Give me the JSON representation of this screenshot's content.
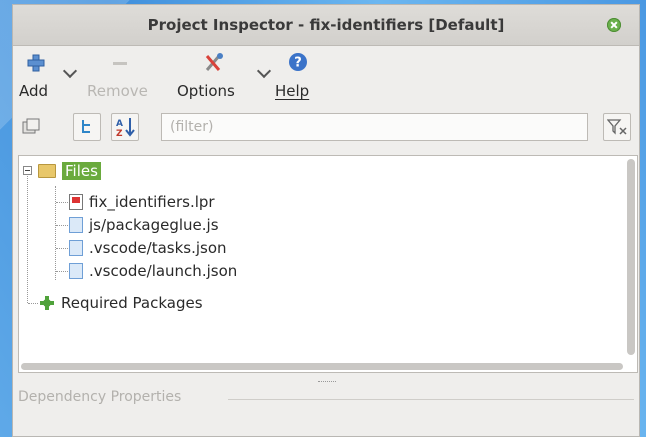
{
  "window": {
    "title": "Project Inspector - fix-identifiers [Default]"
  },
  "toolbar": {
    "add_label": "Add",
    "remove_label": "Remove",
    "options_label": "Options",
    "help_label": "Help"
  },
  "filter": {
    "placeholder": "(filter)"
  },
  "tree": {
    "root_label": "Files",
    "files": [
      {
        "name": "fix_identifiers.lpr",
        "icon": "lpr-file-icon"
      },
      {
        "name": "js/packageglue.js",
        "icon": "file-icon"
      },
      {
        "name": ".vscode/tasks.json",
        "icon": "file-icon"
      },
      {
        "name": ".vscode/launch.json",
        "icon": "file-icon"
      }
    ],
    "required_packages_label": "Required Packages"
  },
  "dependency_properties": {
    "title": "Dependency Properties"
  },
  "colors": {
    "files_highlight": "#6aaa3d",
    "close_button": "#6ab04c"
  }
}
